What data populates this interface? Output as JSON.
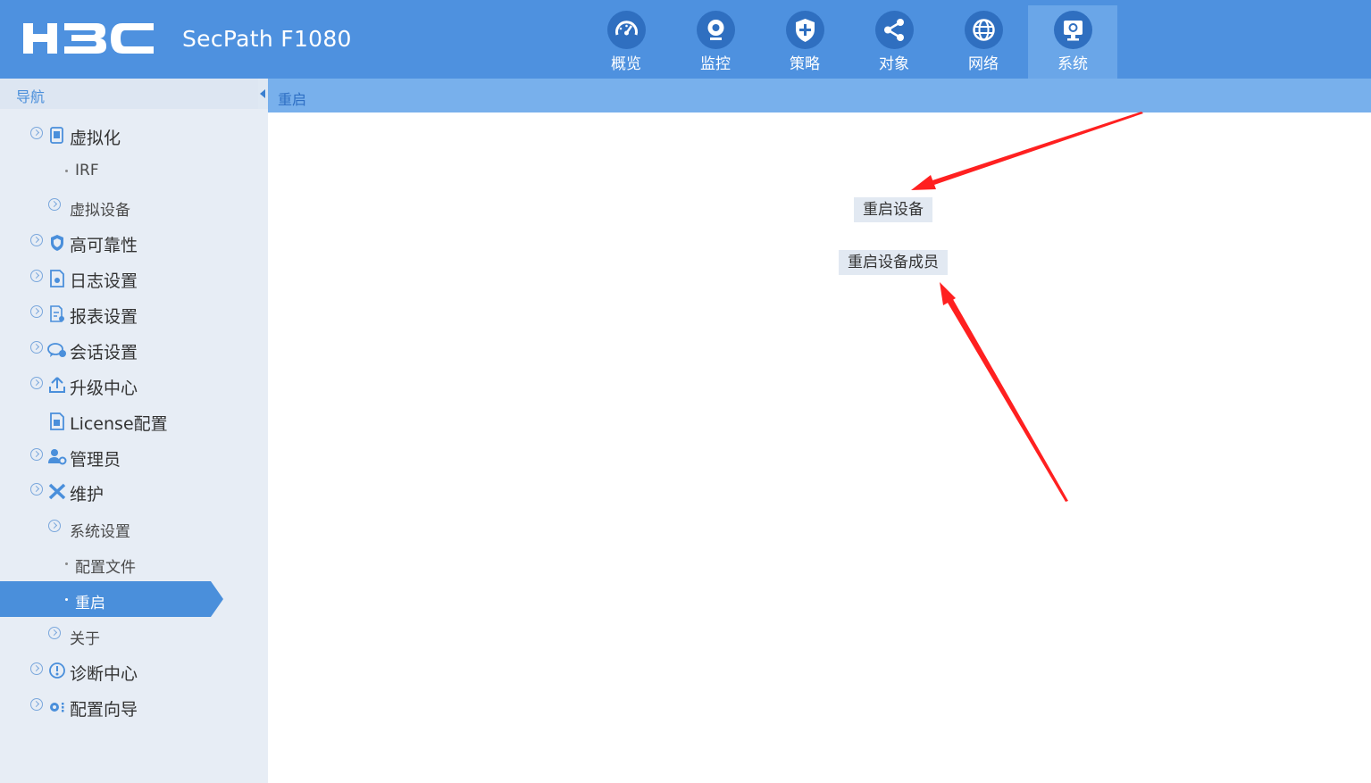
{
  "header": {
    "brand": "H3C",
    "product": "SecPath F1080",
    "tabs": [
      {
        "label": "概览",
        "icon": "speedometer-icon"
      },
      {
        "label": "监控",
        "icon": "webcam-icon"
      },
      {
        "label": "策略",
        "icon": "shield-plus-icon"
      },
      {
        "label": "对象",
        "icon": "share-icon"
      },
      {
        "label": "网络",
        "icon": "globe-icon"
      },
      {
        "label": "系统",
        "icon": "monitor-gear-icon",
        "active": true
      }
    ]
  },
  "sidebar": {
    "title": "导航",
    "items": [
      {
        "label": "虚拟化",
        "level": 1,
        "icon": "virtualization-icon"
      },
      {
        "label": "IRF",
        "level": 3
      },
      {
        "label": "虚拟设备",
        "level": 2
      },
      {
        "label": "高可靠性",
        "level": 1,
        "icon": "shield-icon"
      },
      {
        "label": "日志设置",
        "level": 1,
        "icon": "log-file-icon"
      },
      {
        "label": "报表设置",
        "level": 1,
        "icon": "report-icon"
      },
      {
        "label": "会话设置",
        "level": 1,
        "icon": "session-icon"
      },
      {
        "label": "升级中心",
        "level": 1,
        "icon": "upload-icon"
      },
      {
        "label": "License配置",
        "level": 1,
        "icon": "license-icon"
      },
      {
        "label": "管理员",
        "level": 1,
        "icon": "admin-user-icon"
      },
      {
        "label": "维护",
        "level": 1,
        "icon": "tools-icon"
      },
      {
        "label": "系统设置",
        "level": 2
      },
      {
        "label": "配置文件",
        "level": 3
      },
      {
        "label": "重启",
        "level": 3,
        "selected": true
      },
      {
        "label": "关于",
        "level": 2
      },
      {
        "label": "诊断中心",
        "level": 1,
        "icon": "diagnosis-icon"
      },
      {
        "label": "配置向导",
        "level": 1,
        "icon": "wizard-gear-icon"
      }
    ]
  },
  "breadcrumb": "重启",
  "main": {
    "reboot_device": "重启设备",
    "reboot_member": "重启设备成员"
  },
  "colors": {
    "header_bg": "#4e91df",
    "active_tab": "#6aa6e8",
    "sidebar_bg": "#e7edf5",
    "selected_item": "#4a8fdb",
    "breadcrumb_bg": "#78b0ec",
    "arrow": "#ff2020"
  }
}
